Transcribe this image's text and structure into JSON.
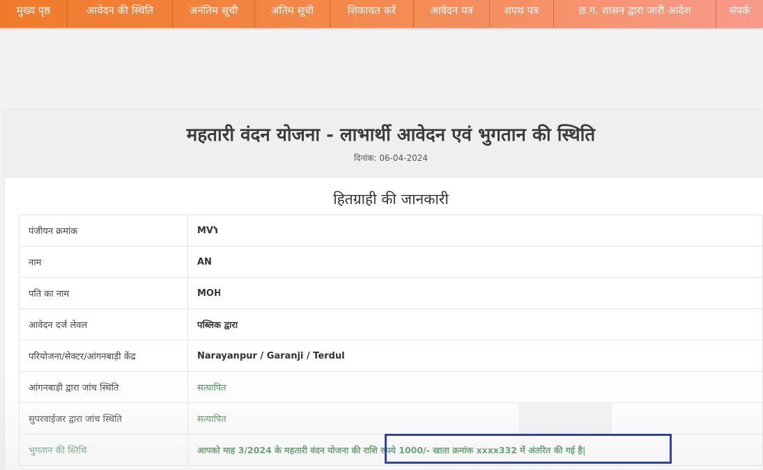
{
  "nav": {
    "items": [
      {
        "label": "मुख्य पृष्ठ"
      },
      {
        "label": "आवेदन की स्थिति"
      },
      {
        "label": "अनंतिम सूची"
      },
      {
        "label": "अंतिम सूची"
      },
      {
        "label": "शिकायत करें"
      },
      {
        "label": "आवेदन पत्र"
      },
      {
        "label": "शपथ पत्र"
      },
      {
        "label": "छ.ग. शासन द्वारा जारी आदेश"
      },
      {
        "label": "संपर्क"
      }
    ]
  },
  "header": {
    "title": "महतारी वंदन योजना - लाभार्थी आवेदन एवं भुगतान की स्थिति",
    "date": "दिनांक: 06-04-2024"
  },
  "section": {
    "title": "हितग्राही की जानकारी"
  },
  "rows": [
    {
      "label": "पंजीयन क्रमांक",
      "value": "MVY"
    },
    {
      "label": "नाम",
      "value": "AN"
    },
    {
      "label": "पति का नाम",
      "value": "MOH"
    },
    {
      "label": "आवेदन दर्ज लेवल",
      "value": "पब्लिक द्वारा"
    },
    {
      "label": "परियोजना/सेक्टर/आंगनबाड़ी केंद्र",
      "value": "Narayanpur / Garanji / Terdul"
    },
    {
      "label": "आंगनबाड़ी द्वारा जांच स्थिति",
      "value": "सत्यापित"
    },
    {
      "label": "सुपरवाईजर द्वारा जांच स्थिति",
      "value": "सत्यापित"
    },
    {
      "label": "भुगतान की स्तिथि",
      "value": "आपको माह 3/2024 के महतारी वंदन योजना की राशि रुपये 1000/- खाता क्रमांक xxxx332 में अंतरित की गई है|"
    }
  ],
  "colors": {
    "nav_start": "#ef7a2a",
    "nav_end": "#f79a8a",
    "status_green": "#3c8c4f",
    "highlight_border": "#2c3fbf"
  }
}
